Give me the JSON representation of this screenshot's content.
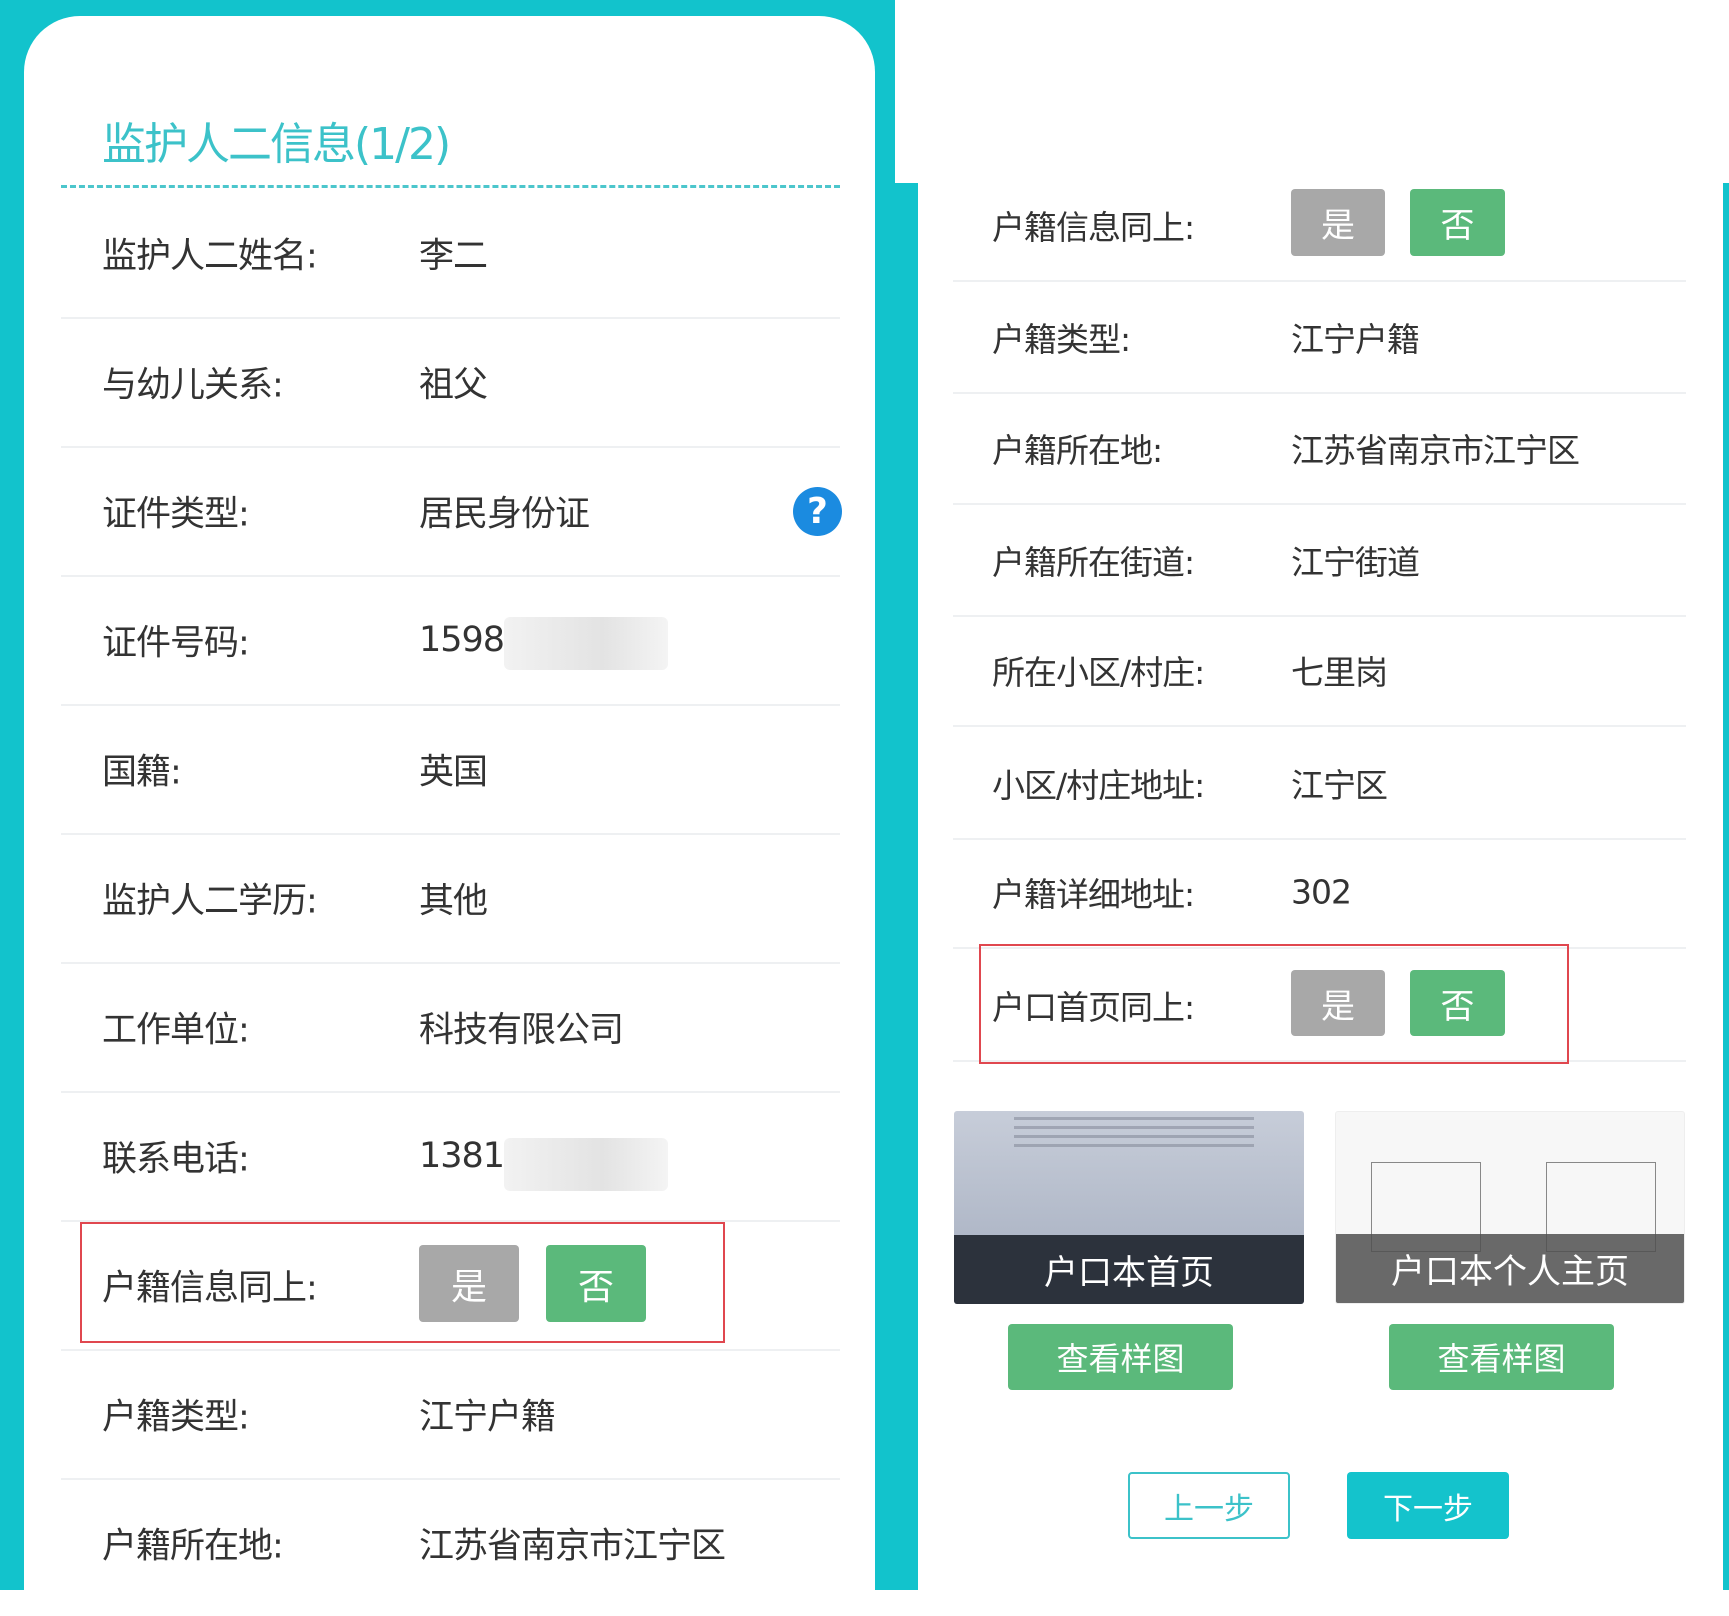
{
  "left": {
    "title": "监护人二信息(1/2)",
    "rows": [
      {
        "label": "监护人二姓名:",
        "value": "李二"
      },
      {
        "label": "与幼儿关系:",
        "value": "祖父"
      },
      {
        "label": "证件类型:",
        "value": "居民身份证"
      },
      {
        "label": "证件号码:",
        "value": "1598"
      },
      {
        "label": "国籍:",
        "value": "英国"
      },
      {
        "label": "监护人二学历:",
        "value": "其他"
      },
      {
        "label": "工作单位:",
        "value": "科技有限公司"
      },
      {
        "label": "联系电话:",
        "value": "1381"
      },
      {
        "label": "户籍信息同上:",
        "value": ""
      },
      {
        "label": "户籍类型:",
        "value": "江宁户籍"
      },
      {
        "label": "户籍所在地:",
        "value": "江苏省南京市江宁区"
      }
    ],
    "help_icon": "question-circle-icon",
    "yes_label": "是",
    "no_label": "否"
  },
  "right": {
    "rows": [
      {
        "label": "户籍信息同上:",
        "value": ""
      },
      {
        "label": "户籍类型:",
        "value": "江宁户籍"
      },
      {
        "label": "户籍所在地:",
        "value": "江苏省南京市江宁区"
      },
      {
        "label": "户籍所在街道:",
        "value": "江宁街道"
      },
      {
        "label": "所在小区/村庄:",
        "value": "七里岗"
      },
      {
        "label": "小区/村庄地址:",
        "value": "江宁区"
      },
      {
        "label": "户籍详细地址:",
        "value": "302"
      },
      {
        "label": "户口首页同上:",
        "value": ""
      }
    ],
    "yes_label": "是",
    "no_label": "否",
    "uploads": [
      {
        "caption": "户口本首页",
        "button": "查看样图"
      },
      {
        "caption": "户口本个人主页",
        "button": "查看样图"
      }
    ],
    "prev_label": "上一步",
    "next_label": "下一步"
  },
  "colors": {
    "teal": "#12c3cc",
    "green": "#5bb97b",
    "gray": "#a8a8a8",
    "red": "#e0474f"
  }
}
